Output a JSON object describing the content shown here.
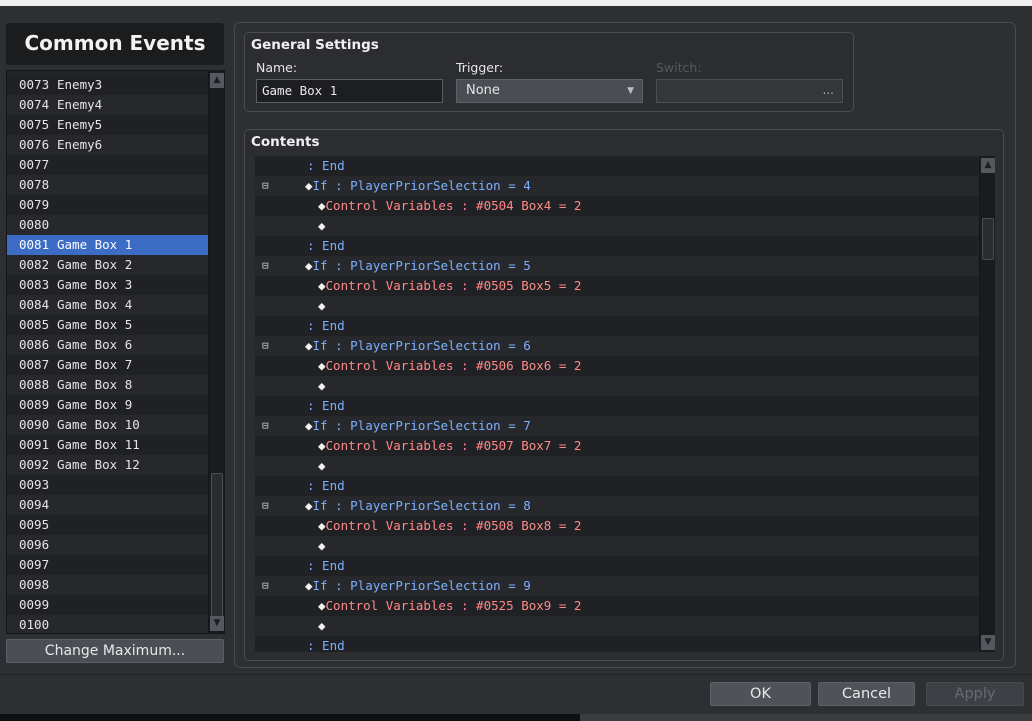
{
  "left_panel": {
    "title": "Common Events",
    "items": [
      {
        "num": "0073",
        "name": "Enemy3"
      },
      {
        "num": "0074",
        "name": "Enemy4"
      },
      {
        "num": "0075",
        "name": "Enemy5"
      },
      {
        "num": "0076",
        "name": "Enemy6"
      },
      {
        "num": "0077",
        "name": ""
      },
      {
        "num": "0078",
        "name": ""
      },
      {
        "num": "0079",
        "name": ""
      },
      {
        "num": "0080",
        "name": ""
      },
      {
        "num": "0081",
        "name": "Game Box 1"
      },
      {
        "num": "0082",
        "name": "Game Box 2"
      },
      {
        "num": "0083",
        "name": "Game Box 3"
      },
      {
        "num": "0084",
        "name": "Game Box 4"
      },
      {
        "num": "0085",
        "name": "Game Box 5"
      },
      {
        "num": "0086",
        "name": "Game Box 6"
      },
      {
        "num": "0087",
        "name": "Game Box 7"
      },
      {
        "num": "0088",
        "name": "Game Box 8"
      },
      {
        "num": "0089",
        "name": "Game Box 9"
      },
      {
        "num": "0090",
        "name": "Game Box 10"
      },
      {
        "num": "0091",
        "name": "Game Box 11"
      },
      {
        "num": "0092",
        "name": "Game Box 12"
      },
      {
        "num": "0093",
        "name": ""
      },
      {
        "num": "0094",
        "name": ""
      },
      {
        "num": "0095",
        "name": ""
      },
      {
        "num": "0096",
        "name": ""
      },
      {
        "num": "0097",
        "name": ""
      },
      {
        "num": "0098",
        "name": ""
      },
      {
        "num": "0099",
        "name": ""
      },
      {
        "num": "0100",
        "name": ""
      }
    ],
    "selected_index": 8,
    "change_max_label": "Change Maximum..."
  },
  "general_settings": {
    "title": "General Settings",
    "name_label": "Name:",
    "name_value": "Game Box 1",
    "trigger_label": "Trigger:",
    "trigger_value": "None",
    "switch_label": "Switch:",
    "switch_button": "..."
  },
  "contents": {
    "title": "Contents",
    "lines": [
      {
        "kind": "end",
        "text": ": End"
      },
      {
        "kind": "if",
        "text": "If : PlayerPriorSelection = 4"
      },
      {
        "kind": "ctl",
        "text": "Control Variables : #0504 Box4 = 2"
      },
      {
        "kind": "blank",
        "text": ""
      },
      {
        "kind": "end",
        "text": ": End"
      },
      {
        "kind": "if",
        "text": "If : PlayerPriorSelection = 5"
      },
      {
        "kind": "ctl",
        "text": "Control Variables : #0505 Box5 = 2"
      },
      {
        "kind": "blank",
        "text": ""
      },
      {
        "kind": "end",
        "text": ": End"
      },
      {
        "kind": "if",
        "text": "If : PlayerPriorSelection = 6"
      },
      {
        "kind": "ctl",
        "text": "Control Variables : #0506 Box6 = 2"
      },
      {
        "kind": "blank",
        "text": ""
      },
      {
        "kind": "end",
        "text": ": End"
      },
      {
        "kind": "if",
        "text": "If : PlayerPriorSelection = 7"
      },
      {
        "kind": "ctl",
        "text": "Control Variables : #0507 Box7 = 2"
      },
      {
        "kind": "blank",
        "text": ""
      },
      {
        "kind": "end",
        "text": ": End"
      },
      {
        "kind": "if",
        "text": "If : PlayerPriorSelection = 8"
      },
      {
        "kind": "ctl",
        "text": "Control Variables : #0508 Box8 = 2"
      },
      {
        "kind": "blank",
        "text": ""
      },
      {
        "kind": "end",
        "text": ": End"
      },
      {
        "kind": "if",
        "text": "If : PlayerPriorSelection = 9"
      },
      {
        "kind": "ctl",
        "text": "Control Variables : #0525 Box9 = 2"
      },
      {
        "kind": "blank",
        "text": ""
      },
      {
        "kind": "end",
        "text": ": End"
      }
    ]
  },
  "dialog_buttons": {
    "ok": "OK",
    "cancel": "Cancel",
    "apply": "Apply"
  },
  "icons": {
    "fold": "collapse-minus-icon",
    "command": "diamond-icon",
    "dropdown": "triangle-down-icon",
    "scroll_up": "triangle-up-icon",
    "scroll_down": "triangle-down-icon"
  }
}
